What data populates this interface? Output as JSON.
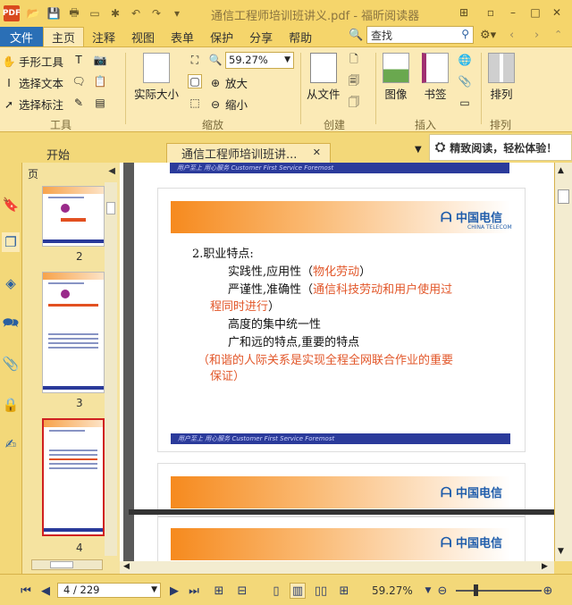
{
  "window": {
    "title": "通信工程师培训班讲义.pdf - 福昕阅读器",
    "logo_text": "PDF"
  },
  "menu": {
    "file": "文件",
    "items": [
      "主页",
      "注释",
      "视图",
      "表单",
      "保护",
      "分享",
      "帮助"
    ]
  },
  "search": {
    "placeholder": "查找"
  },
  "ribbon": {
    "hand_tool": "手形工具",
    "select_text": "选择文本",
    "select_annot": "选择标注",
    "actual_size": "实际大小",
    "zoom_value": "59.27%",
    "zoom_in": "放大",
    "zoom_out": "缩小",
    "from_file": "从文件",
    "image": "图像",
    "bookmark": "书签",
    "arrange": "排列",
    "groups": {
      "tools": "工具",
      "zoom": "缩放",
      "create": "创建",
      "insert": "插入",
      "arrange": "排列"
    }
  },
  "tabs": {
    "start": "开始",
    "doc": "通信工程师培训班讲..."
  },
  "promo": "精致阅读，轻松体验！",
  "sidebar": {
    "header": "页",
    "thumbs": [
      "2",
      "3",
      "4"
    ]
  },
  "slide_top": {
    "footer": "用户至上 用心服务 Customer First Service Foremost"
  },
  "slide": {
    "logo": "中国电信",
    "logo_sub": "CHINA TELECOM",
    "heading": "2.职业特点:",
    "l1a": "实践性,应用性（",
    "l1b": "物化劳动",
    "l1c": "）",
    "l2a": "严谨性,准确性（",
    "l2b": "通信科技劳动和用户使用过",
    "l3b": "程同时进行",
    "l3c": "）",
    "l4": "高度的集中统一性",
    "l5": "广和远的特点,重要的特点",
    "l6": "（和谐的人际关系是实现全程全网联合作业的重要",
    "l7": "保证）",
    "footer": "用户至上 用心服务 Customer First Service Foremost"
  },
  "status": {
    "page": "4 / 229",
    "zoom": "59.27%"
  }
}
